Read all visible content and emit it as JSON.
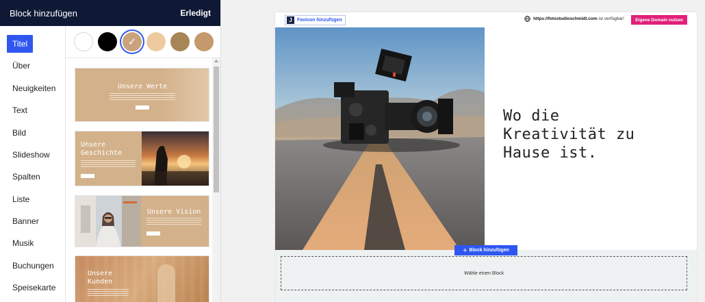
{
  "panel": {
    "title": "Block hinzufügen",
    "done_label": "Erledigt"
  },
  "categories": [
    {
      "label": "Titel",
      "active": true
    },
    {
      "label": "Über",
      "active": false
    },
    {
      "label": "Neuigkeiten",
      "active": false
    },
    {
      "label": "Text",
      "active": false
    },
    {
      "label": "Bild",
      "active": false
    },
    {
      "label": "Slideshow",
      "active": false
    },
    {
      "label": "Spalten",
      "active": false
    },
    {
      "label": "Liste",
      "active": false
    },
    {
      "label": "Banner",
      "active": false
    },
    {
      "label": "Musik",
      "active": false
    },
    {
      "label": "Buchungen",
      "active": false
    },
    {
      "label": "Speisekarte",
      "active": false
    }
  ],
  "swatches": [
    {
      "color": "#ffffff",
      "selected": false
    },
    {
      "color": "#000000",
      "selected": false
    },
    {
      "color": "#c9a37c",
      "selected": true
    },
    {
      "color": "#eecb9e",
      "selected": false
    },
    {
      "color": "#a88557",
      "selected": false
    },
    {
      "color": "#c49a6c",
      "selected": false
    }
  ],
  "thumbnails": [
    {
      "title": "Unsere Werte"
    },
    {
      "title": "Unsere Geschichte"
    },
    {
      "title": "Unsere Vision"
    },
    {
      "title": "Unsere Kunden"
    }
  ],
  "preview": {
    "favicon_badge": "J",
    "favicon_label": "Favicon hinzufügen",
    "domain_url": "https://fotostudioschmidt.com",
    "domain_suffix": " ist verfügbar!",
    "own_domain_label": "Eigene Domain nutzen",
    "hero_line1": "Wo die",
    "hero_line2": "Kreativität zu",
    "hero_line3": "Hause ist.",
    "add_block_label": "Block hinzufügen",
    "choose_block_label": "Wähle einen Block"
  },
  "colors": {
    "accent": "#2f57f0",
    "header_bg": "#0f1935",
    "domain_button": "#e0217b",
    "thumb_tan": "#d3b18a"
  }
}
